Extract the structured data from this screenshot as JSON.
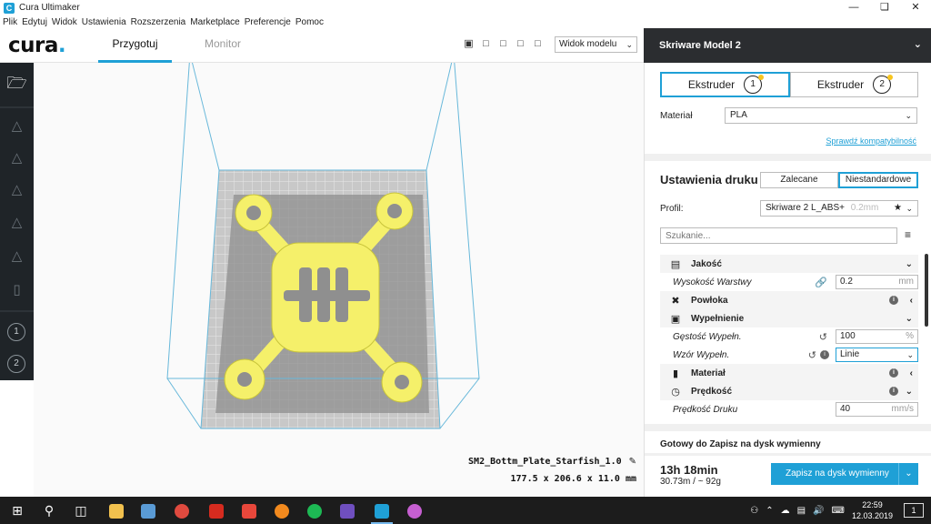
{
  "window": {
    "title": "Cura Ultimaker"
  },
  "menu": [
    "Plik",
    "Edytuj",
    "Widok",
    "Ustawienia",
    "Rozszerzenia",
    "Marketplace",
    "Preferencje",
    "Pomoc"
  ],
  "header": {
    "logo": "cura",
    "tabs": [
      {
        "label": "Przygotuj",
        "active": true
      },
      {
        "label": "Monitor",
        "active": false
      }
    ],
    "view_select": "Widok modelu"
  },
  "left_toolbar": {
    "extruders": [
      "1",
      "2"
    ]
  },
  "model": {
    "name": "SM2_Bottm_Plate_Starfish_1.0",
    "dims": "177.5 x 206.6 x 11.0 mm",
    "color": "#f5f06a"
  },
  "printer": {
    "name": "Skriware Model 2"
  },
  "extruders": [
    {
      "label": "Ekstruder",
      "num": "1",
      "active": true
    },
    {
      "label": "Ekstruder",
      "num": "2",
      "active": false
    }
  ],
  "material": {
    "label": "Materiał",
    "value": "PLA",
    "link": "Sprawdź kompatybilność"
  },
  "print_settings": {
    "title": "Ustawienia druku",
    "modes": [
      {
        "label": "Zalecane",
        "active": false
      },
      {
        "label": "Niestandardowe",
        "active": true
      }
    ],
    "profile_label": "Profil:",
    "profile_value": "Skriware 2 L_ABS+",
    "profile_hint": "0.2mm",
    "search_placeholder": "Szukanie..."
  },
  "settings": {
    "quality": {
      "label": "Jakość"
    },
    "layer_height": {
      "label": "Wysokość Warstwy",
      "value": "0.2",
      "unit": "mm"
    },
    "shell": {
      "label": "Powłoka"
    },
    "infill": {
      "label": "Wypełnienie"
    },
    "infill_density": {
      "label": "Gęstość Wypełn.",
      "value": "100",
      "unit": "%"
    },
    "infill_pattern": {
      "label": "Wzór Wypełn.",
      "value": "Linie"
    },
    "material": {
      "label": "Materiał"
    },
    "speed": {
      "label": "Prędkość"
    },
    "print_speed": {
      "label": "Prędkość Druku",
      "value": "40",
      "unit": "mm/s"
    }
  },
  "footer": {
    "ready": "Gotowy do Zapisz na dysk wymienny",
    "time": "13h 18min",
    "stats": "30.73m / ~ 92g",
    "save_button": "Zapisz na dysk wymienny"
  },
  "taskbar": {
    "time": "22:59",
    "date": "12.03.2019",
    "notifications": "1"
  },
  "colors": {
    "accent": "#1fa0d6",
    "dark": "#1f2428",
    "model": "#f5f06a"
  }
}
